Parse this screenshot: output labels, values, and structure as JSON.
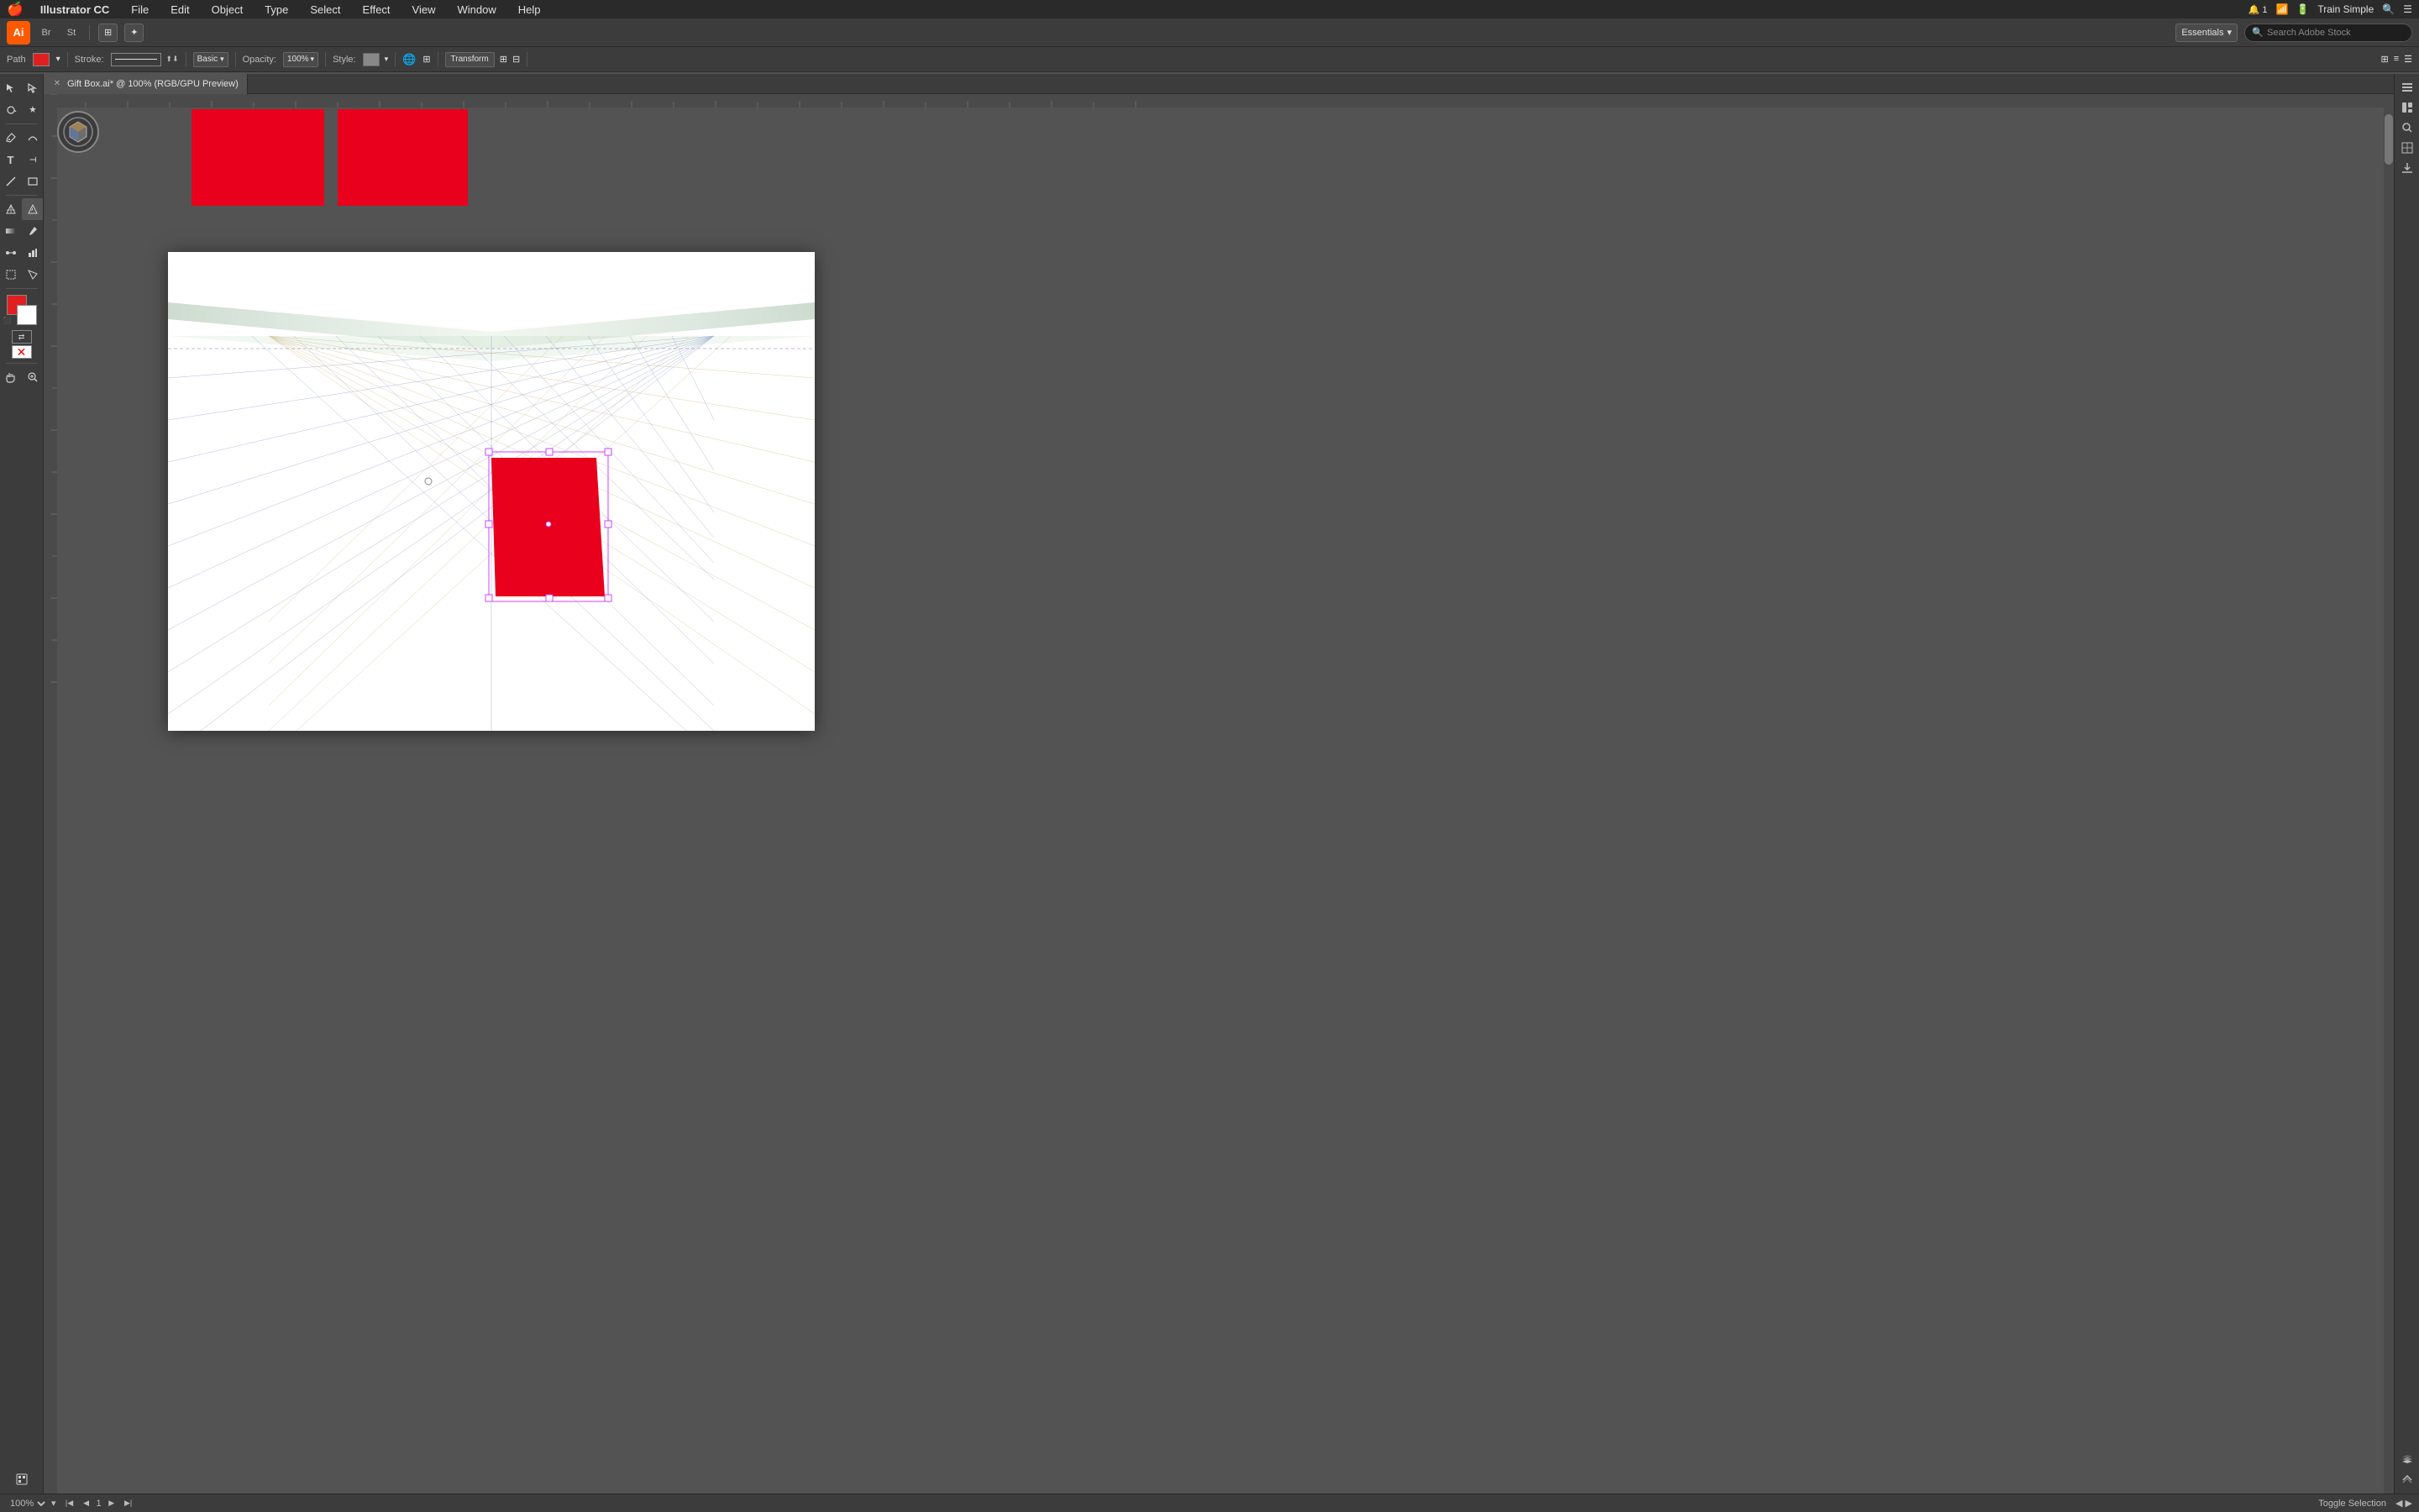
{
  "menubar": {
    "apple": "🍎",
    "brand": "Illustrator CC",
    "menus": [
      "File",
      "Edit",
      "Object",
      "Type",
      "Select",
      "Effect",
      "View",
      "Window",
      "Help"
    ],
    "right": {
      "wifi": "wifi",
      "battery": "battery",
      "app_name": "Train Simple",
      "search_icon": "🔍"
    }
  },
  "app_toolbar": {
    "essentials": "Essentials",
    "search_placeholder": "Search Adobe Stock",
    "icons": [
      "bridge",
      "stock",
      "arrange",
      "brush"
    ]
  },
  "props_toolbar": {
    "path_label": "Path",
    "fill_color": "#e02020",
    "stroke_label": "Stroke:",
    "stroke_value": "",
    "stroke_type": "Basic",
    "opacity_label": "Opacity:",
    "opacity_value": "100%",
    "style_label": "Style:",
    "transform_label": "Transform"
  },
  "document": {
    "title": "Gift Box.ai",
    "zoom": "100%",
    "color_mode": "RGB/GPU Preview"
  },
  "status_bar": {
    "zoom_value": "100%",
    "artboard_nav": "1",
    "toggle_selection": "Toggle Selection"
  },
  "canvas": {
    "artboard_bg": "#ffffff",
    "red_fill": "#e8001c",
    "selection_color": "#cc66ff"
  },
  "tools": {
    "items": [
      {
        "name": "selection-tool",
        "icon": "↖",
        "active": false
      },
      {
        "name": "direct-selection-tool",
        "icon": "↗",
        "active": false
      },
      {
        "name": "lasso-tool",
        "icon": "⊙",
        "active": false
      },
      {
        "name": "magic-wand-tool",
        "icon": "✦",
        "active": false
      },
      {
        "name": "pen-tool",
        "icon": "✒",
        "active": false
      },
      {
        "name": "pencil-tool",
        "icon": "✏",
        "active": false
      },
      {
        "name": "type-tool",
        "icon": "T",
        "active": false
      },
      {
        "name": "line-tool",
        "icon": "╱",
        "active": false
      },
      {
        "name": "rectangle-tool",
        "icon": "▭",
        "active": false
      },
      {
        "name": "scissors-tool",
        "icon": "✂",
        "active": false
      },
      {
        "name": "rotate-tool",
        "icon": "↻",
        "active": false
      },
      {
        "name": "scale-tool",
        "icon": "⤢",
        "active": false
      },
      {
        "name": "perspective-grid-tool",
        "icon": "⊞",
        "active": false
      },
      {
        "name": "perspective-selection-tool",
        "icon": "⊡",
        "active": true
      },
      {
        "name": "gradient-tool",
        "icon": "◫",
        "active": false
      },
      {
        "name": "eyedropper-tool",
        "icon": "⊘",
        "active": false
      },
      {
        "name": "blend-tool",
        "icon": "⌀",
        "active": false
      },
      {
        "name": "chart-tool",
        "icon": "▦",
        "active": false
      },
      {
        "name": "artboard-tool",
        "icon": "⊔",
        "active": false
      },
      {
        "name": "warp-tool",
        "icon": "〜",
        "active": false
      },
      {
        "name": "hand-tool",
        "icon": "☛",
        "active": false
      },
      {
        "name": "zoom-tool",
        "icon": "⊕",
        "active": false
      }
    ]
  }
}
